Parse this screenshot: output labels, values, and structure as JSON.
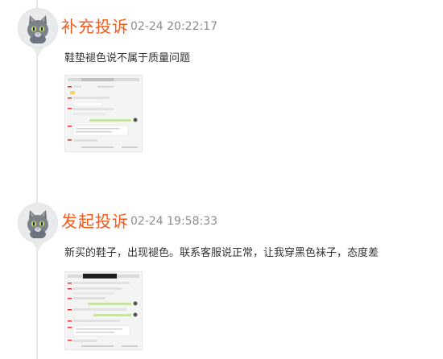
{
  "entries": [
    {
      "title": "补充投诉",
      "time": "02-24 20:22:17",
      "description": "鞋垫褪色说不属于质量问题",
      "avatar_icon": "cat-avatar-icon",
      "attachment_icon": "chat-screenshot-thumbnail"
    },
    {
      "title": "发起投诉",
      "time": "02-24 19:58:33",
      "description": "新买的鞋子，出现褪色。联系客服说正常，让我穿黑色袜子，态度差",
      "avatar_icon": "cat-avatar-icon",
      "attachment_icon": "chat-screenshot-thumbnail"
    }
  ],
  "colors": {
    "title": "#f35a1e",
    "time": "#8c8c8c",
    "text": "#333333",
    "timeline": "#e6e6e6",
    "avatar_bg": "#e9eaec"
  }
}
